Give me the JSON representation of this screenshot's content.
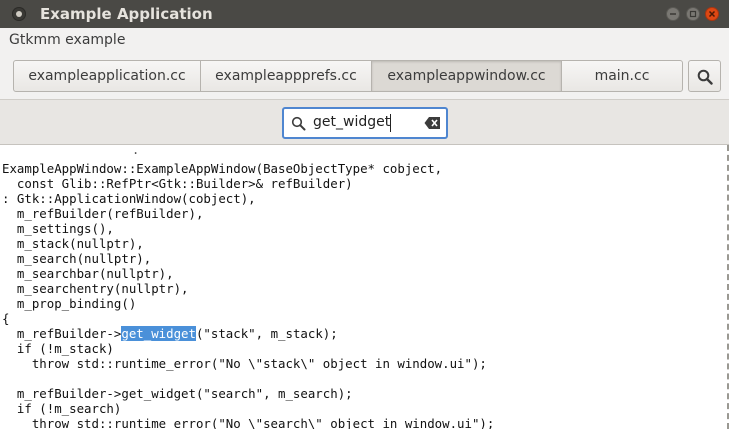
{
  "window": {
    "title": "Example Application"
  },
  "menubar": {
    "items": [
      "Gtkmm example"
    ]
  },
  "tabs": [
    {
      "label": "exampleapplication.cc",
      "active": false
    },
    {
      "label": "exampleappprefs.cc",
      "active": false
    },
    {
      "label": "exampleappwindow.cc",
      "active": true
    },
    {
      "label": "main.cc",
      "active": false
    }
  ],
  "search": {
    "value": "get_widget"
  },
  "editor": {
    "lines": [
      "ExampleAppWindow::ExampleAppWindow(BaseObjectType* cobject,",
      "  const Glib::RefPtr<Gtk::Builder>& refBuilder)",
      ": Gtk::ApplicationWindow(cobject),",
      "  m_refBuilder(refBuilder),",
      "  m_settings(),",
      "  m_stack(nullptr),",
      "  m_search(nullptr),",
      "  m_searchbar(nullptr),",
      "  m_searchentry(nullptr),",
      "  m_prop_binding()",
      "{",
      "  m_refBuilder->get_widget(\"stack\", m_stack);",
      "  if (!m_stack)",
      "    throw std::runtime_error(\"No \\\"stack\\\" object in window.ui\");",
      "",
      "  m_refBuilder->get_widget(\"search\", m_search);",
      "  if (!m_search)",
      "    throw std::runtime_error(\"No \\\"search\\\" object in window.ui\");"
    ],
    "highlight": {
      "line": 11,
      "text": "get_widget"
    }
  },
  "colors": {
    "titlebar": "#4a4945",
    "close": "#dd4814",
    "accent": "#4f86d0",
    "highlight": "#4a90d9"
  },
  "icons": {
    "search": "search-icon",
    "clear": "clear-icon",
    "close": "close-icon",
    "minimize": "minimize-icon",
    "maximize": "maximize-icon"
  }
}
